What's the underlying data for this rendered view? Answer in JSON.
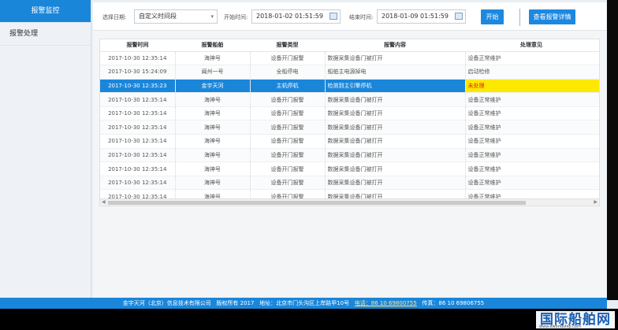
{
  "sidebar": {
    "items": [
      {
        "label": "报警监控"
      },
      {
        "label": "报警处理"
      }
    ]
  },
  "filters": {
    "select_label": "选择日期:",
    "select_value": "自定义时间段",
    "start_label": "开始时间:",
    "start_value": "2018-01-02 01:51:59",
    "end_label": "结束时间:",
    "end_value": "2018-01-09 01:51:59",
    "start_button": "开始",
    "report_button": "查看报警详情"
  },
  "table": {
    "headers": [
      "报警时间",
      "报警船舶",
      "报警类型",
      "报警内容",
      "处理意见"
    ],
    "rows": [
      [
        "2017-10-30 12:35:14",
        "海神号",
        "设备开门报警",
        "数据采集设备门被打开",
        "设备正常维护"
      ],
      [
        "2017-10-30 15:24:09",
        "闽州一号",
        "全船停电",
        "船舶主电源掉电",
        "启动检修"
      ],
      [
        "2017-10-30 12:35:23",
        "金宇天河",
        "主机停机",
        "检测到主引擎停机",
        "未处理"
      ],
      [
        "2017-10-30 12:35:14",
        "海神号",
        "设备开门报警",
        "数据采集设备门被打开",
        "设备正常维护"
      ],
      [
        "2017-10-30 12:35:14",
        "海神号",
        "设备开门报警",
        "数据采集设备门被打开",
        "设备正常维护"
      ],
      [
        "2017-10-30 12:35:14",
        "海神号",
        "设备开门报警",
        "数据采集设备门被打开",
        "设备正常维护"
      ],
      [
        "2017-10-30 12:35:14",
        "海神号",
        "设备开门报警",
        "数据采集设备门被打开",
        "设备正常维护"
      ],
      [
        "2017-10-30 12:35:14",
        "海神号",
        "设备开门报警",
        "数据采集设备门被打开",
        "设备正常维护"
      ],
      [
        "2017-10-30 12:35:14",
        "海神号",
        "设备开门报警",
        "数据采集设备门被打开",
        "设备正常维护"
      ],
      [
        "2017-10-30 12:35:14",
        "海神号",
        "设备开门报警",
        "数据采集设备门被打开",
        "设备正常维护"
      ],
      [
        "2017-10-30 12:35:14",
        "海神号",
        "设备开门报警",
        "数据采集设备门被打开",
        "设备正常维护"
      ]
    ],
    "selected_row": 2
  },
  "footer": {
    "company": "金宇天河（北京）信息技术有限公司",
    "copyright": "版权所有 2017",
    "address": "地址：北京市门头沟区上岸路甲10号",
    "phone": "电话：86 10 69800755",
    "fax": "传真：86 10 69806755"
  },
  "watermark": {
    "text": "国际船舶网",
    "sub": "www.eworldship.com"
  },
  "colors": {
    "accent": "#1a86da",
    "highlight": "#fde800",
    "alert_text": "#e21c1c"
  }
}
